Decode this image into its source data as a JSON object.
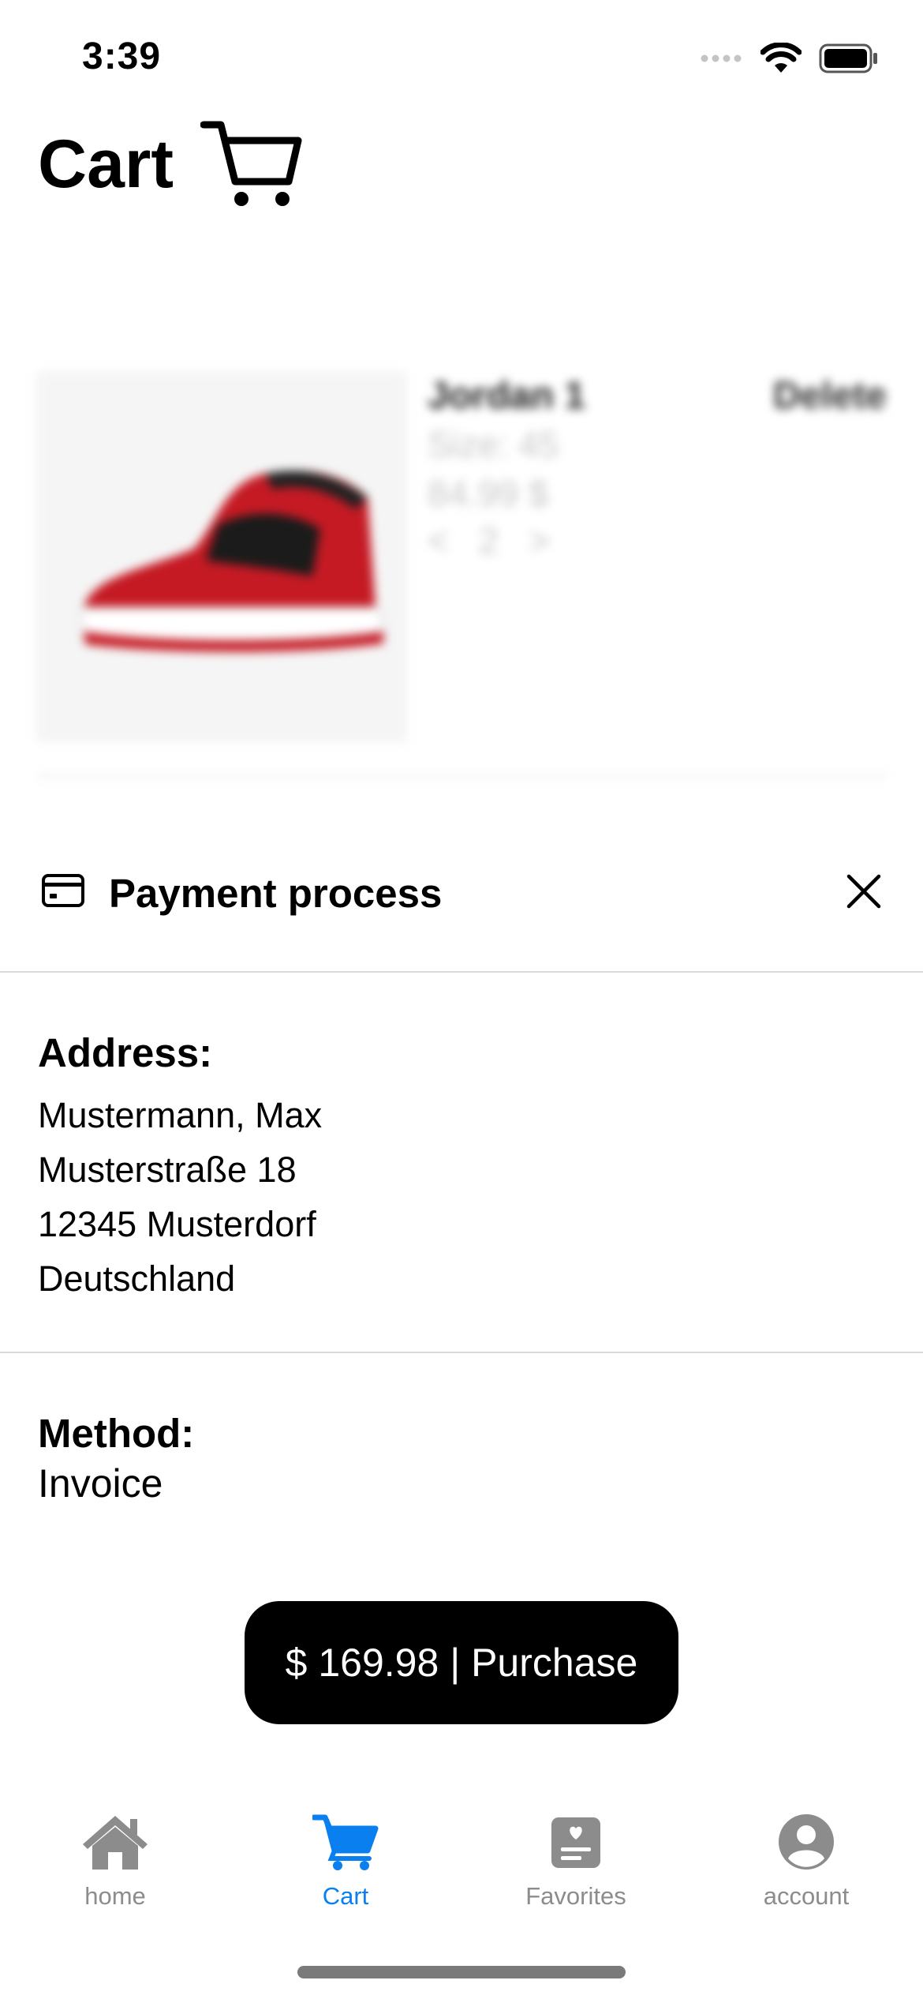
{
  "status_bar": {
    "time": "3:39"
  },
  "header": {
    "title": "Cart"
  },
  "product": {
    "name": "Jordan 1",
    "delete_label": "Delete",
    "size": "Size: 45",
    "price": "84.99 $",
    "qty_decrease": "<",
    "quantity": "2",
    "qty_increase": ">"
  },
  "payment": {
    "title": "Payment process",
    "address_label": "Address:",
    "address_lines": [
      "Mustermann, Max",
      "Musterstraße 18",
      "12345 Musterdorf",
      "Deutschland"
    ],
    "method_label": "Method:",
    "method_value": "Invoice",
    "purchase_label": "$ 169.98 | Purchase"
  },
  "tabs": [
    {
      "label": "home",
      "icon": "home-icon",
      "active": false
    },
    {
      "label": "Cart",
      "icon": "cart-icon",
      "active": true
    },
    {
      "label": "Favorites",
      "icon": "favorites-icon",
      "active": false
    },
    {
      "label": "account",
      "icon": "account-icon",
      "active": false
    }
  ],
  "colors": {
    "accent": "#0A7FF0",
    "inactive_tab": "#8C8C8C",
    "button_bg": "#000000"
  }
}
